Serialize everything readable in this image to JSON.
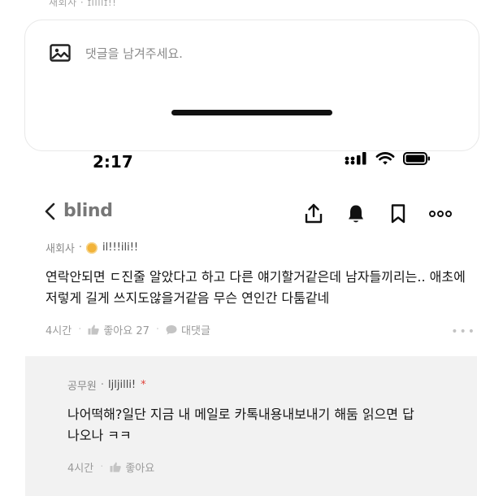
{
  "top_residual_text": "새회사 · ɪlıııɪ!!",
  "comment_input": {
    "placeholder": "댓글을 남겨주세요."
  },
  "status_bar": {
    "time": "2:17"
  },
  "nav": {
    "brand": "blind",
    "icons": [
      "share-icon",
      "bell-icon",
      "bookmark-icon",
      "more-icon"
    ]
  },
  "comment": {
    "company": "새회사",
    "separator": "·",
    "username": "il!!!ili!!",
    "text": "연락안되면 ㄷ진줄 알았다고 하고 다른 얘기할거같은데 남자들끼리는.. 애초에 저렇게 길게 쓰지도않을거같음 무슨 연인간 다툼같네",
    "time": "4시간",
    "like_label": "좋아요 27",
    "reply_label": "대댓글",
    "more": "•••"
  },
  "reply": {
    "company": "공무원",
    "separator": "·",
    "username": "ljljilli!",
    "op_mark": "*",
    "text": "나어떡해?일단 지금 내 메일로 카톡내용내보내기 해둠 읽으면 답나오나 ㅋㅋ",
    "time": "4시간",
    "like_label": "좋아요"
  },
  "colors": {
    "accent_badge": "#f2b33a",
    "op_star": "#e0433b",
    "reply_bg": "#f2f2f2"
  }
}
